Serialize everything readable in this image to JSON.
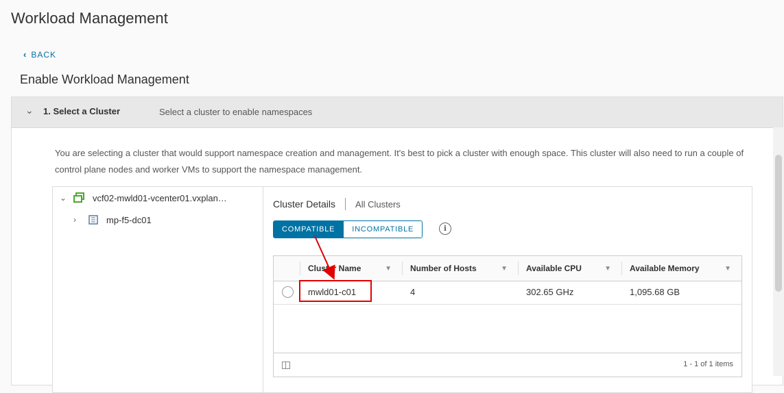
{
  "header": {
    "title": "Workload Management"
  },
  "nav": {
    "back_label": "BACK"
  },
  "wizard": {
    "title": "Enable Workload Management",
    "step": {
      "label": "1. Select a Cluster",
      "description": "Select a cluster to enable namespaces"
    },
    "intro_text": "You are selecting a cluster that would support namespace creation and management. It's best to pick a cluster with enough space. This cluster will also need to run a couple of control plane nodes and worker VMs to support the namespace management."
  },
  "tree": {
    "items": [
      {
        "label": "vcf02-mwld01-vcenter01.vxplan…",
        "icon": "vcenter-icon",
        "expanded": true
      },
      {
        "label": "mp-f5-dc01",
        "icon": "datacenter-icon",
        "expanded": false
      }
    ]
  },
  "details": {
    "title": "Cluster Details",
    "all_link": "All Clusters",
    "tabs": [
      {
        "label": "COMPATIBLE",
        "active": true
      },
      {
        "label": "INCOMPATIBLE",
        "active": false
      }
    ],
    "columns": [
      "Cluster Name",
      "Number of Hosts",
      "Available CPU",
      "Available Memory"
    ],
    "rows": [
      {
        "name": "mwld01-c01",
        "hosts": "4",
        "cpu": "302.65 GHz",
        "memory": "1,095.68 GB"
      }
    ],
    "pager": "1 - 1 of 1 items"
  },
  "colors": {
    "accent": "#0072a3",
    "highlight": "#e00000",
    "vcenter_icon": "#4ba82e"
  }
}
